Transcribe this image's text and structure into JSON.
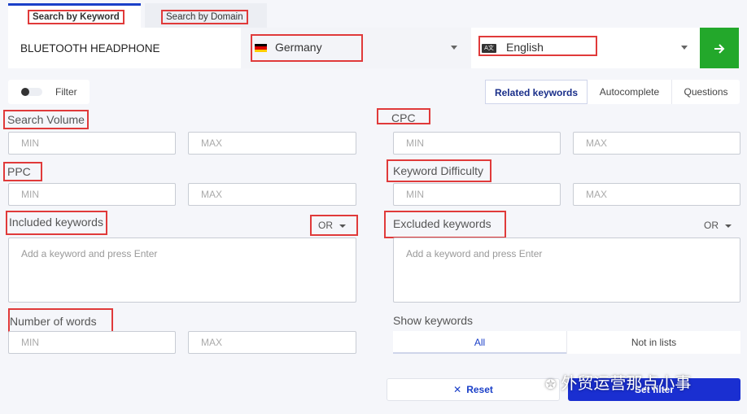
{
  "tabs": {
    "keyword": "Search by Keyword",
    "domain": "Search by Domain"
  },
  "search": {
    "keyword_value": "BLUETOOTH HEADPHONE",
    "country": "Germany",
    "language": "English",
    "go_icon": "arrow-right-icon"
  },
  "filter": {
    "label": "Filter"
  },
  "related_tabs": [
    "Related keywords",
    "Autocomplete",
    "Questions"
  ],
  "fields": {
    "search_volume": "Search Volume",
    "cpc": "CPC",
    "ppc": "PPC",
    "keyword_difficulty": "Keyword Difficulty",
    "included_keywords": "Included keywords",
    "excluded_keywords": "Excluded keywords",
    "number_of_words": "Number of words",
    "show_keywords": "Show keywords",
    "min_placeholder": "MIN",
    "max_placeholder": "MAX",
    "keyword_placeholder": "Add a keyword and press Enter",
    "or_label": "OR"
  },
  "show_keywords_options": [
    "All",
    "Not in lists"
  ],
  "buttons": {
    "reset": "Reset",
    "set_filter": "Set filter"
  },
  "watermark": "外贸运营那点小事",
  "colors": {
    "accent_blue": "#1a3fc8",
    "go_green": "#23a82b",
    "highlight_red": "#e03a3a"
  }
}
